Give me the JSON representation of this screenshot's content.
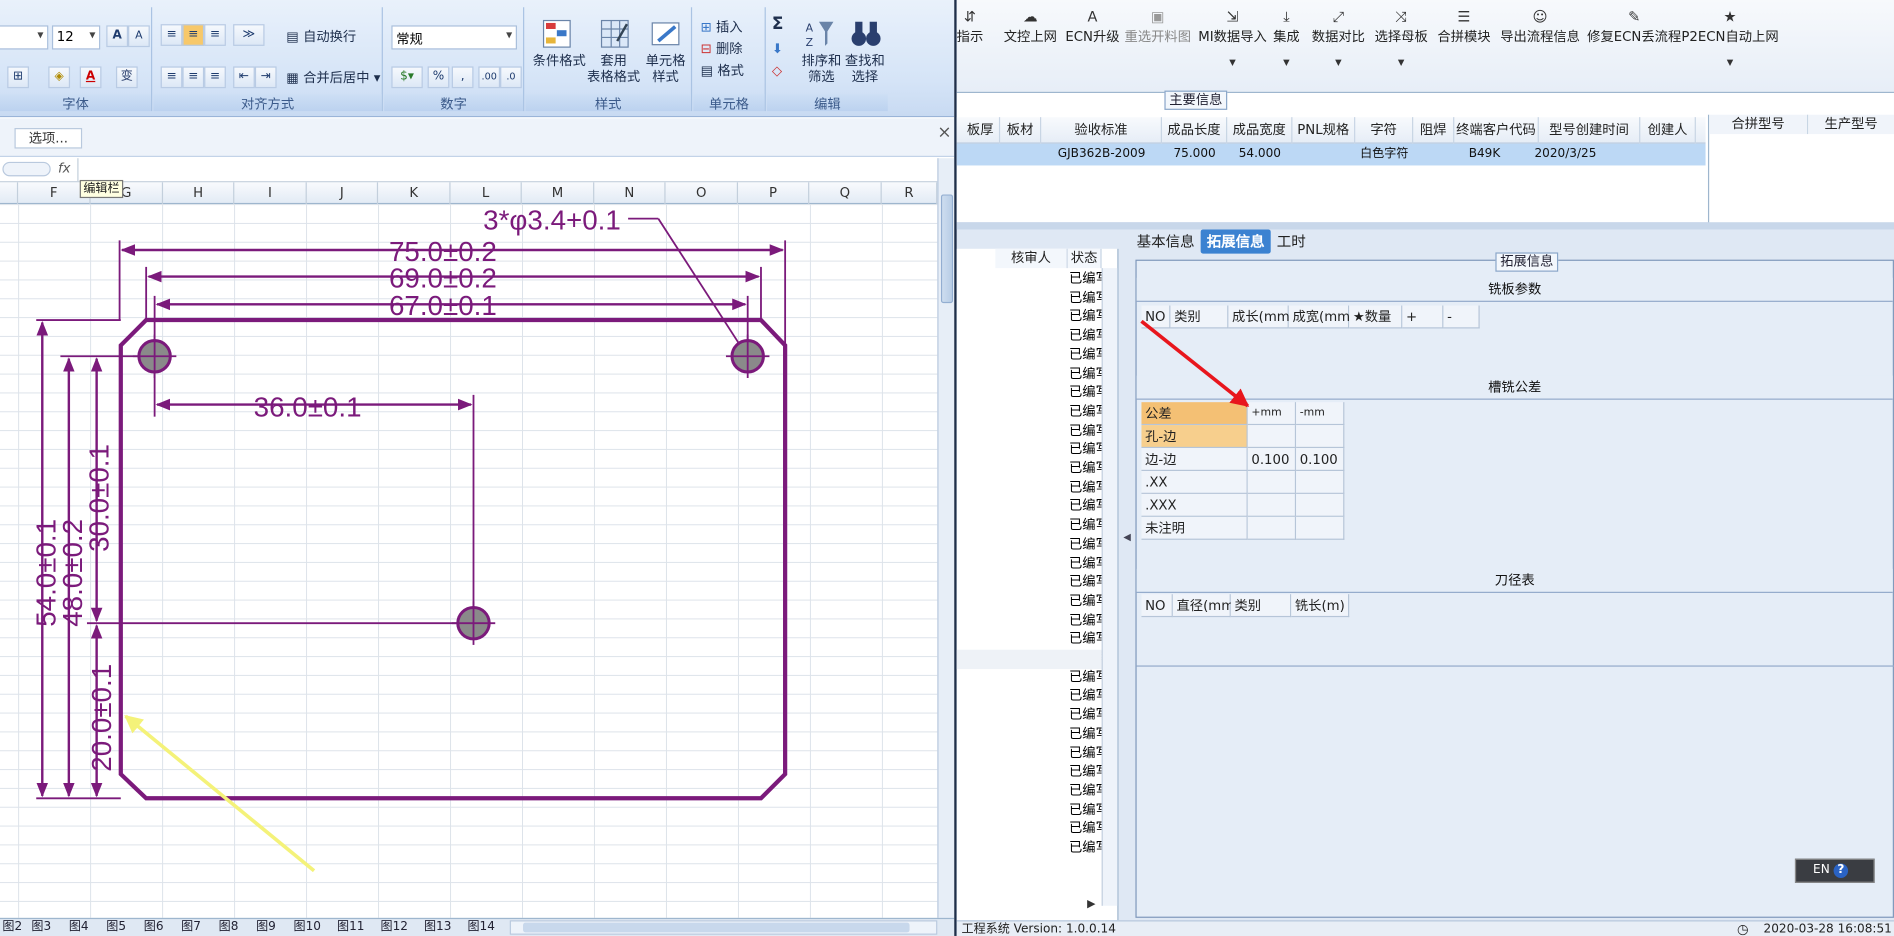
{
  "excel": {
    "font_size": "12",
    "wrap_text": "自动换行",
    "merge_center": "合并后居中",
    "number_format": "常规",
    "percent": "%",
    "comma": ",",
    "dec_inc": ".00",
    "dec_dec": ".0",
    "cond_format": "条件格式",
    "table_format": "套用\n表格格式",
    "cell_style": "单元格\n样式",
    "insert": "插入",
    "delete": "删除",
    "format": "格式",
    "sigma": "Σ",
    "sort_filter": "排序和\n筛选",
    "find_select": "查找和\n选择",
    "group_labels": [
      "字体",
      "对齐方式",
      "数字",
      "样式",
      "单元格",
      "编辑"
    ],
    "options_button": "选项...",
    "close": "×",
    "fx": "fx",
    "tooltip": "编辑栏",
    "columns": [
      "F",
      "G",
      "H",
      "I",
      "J",
      "K",
      "L",
      "M",
      "N",
      "O",
      "P",
      "Q",
      "R"
    ],
    "sheet_tabs": [
      "图2",
      "图3",
      "图4",
      "图5",
      "图6",
      "图7",
      "图8",
      "图9",
      "图10",
      "图11",
      "图12",
      "图13",
      "图14"
    ],
    "drawing": {
      "hole_label": "3*φ3.4+0.1",
      "dim_75": "75.0±0.2",
      "dim_69": "69.0±0.2",
      "dim_67": "67.0±0.1",
      "dim_36": "36.0±0.1",
      "dim_30": "30.0±0.1",
      "dim_54": "54.0±0.1",
      "dim_48": "48.0±0.2",
      "dim_20": "20.0±0.1"
    }
  },
  "toolbar": [
    {
      "icon": "⇵",
      "label": "指示"
    },
    {
      "icon": "☁",
      "label": "文控上网"
    },
    {
      "icon": "A",
      "label": "ECN升级"
    },
    {
      "icon": "▣",
      "label": "重选开料图"
    },
    {
      "icon": "⇲",
      "label": "MI数据导入"
    },
    {
      "icon": "⤓",
      "label": "集成"
    },
    {
      "icon": "⤢",
      "label": "数据对比"
    },
    {
      "icon": "⤨",
      "label": "选择母板"
    },
    {
      "icon": "☰",
      "label": "合拼模块"
    },
    {
      "icon": "☺",
      "label": "导出流程信息"
    },
    {
      "icon": "✎",
      "label": "修复ECN丢流程"
    },
    {
      "icon": "★",
      "label": "P2ECN自动上网"
    }
  ],
  "main_info": {
    "title": "主要信息",
    "headers": [
      "板厚",
      "板材",
      "验收标准",
      "成品长度",
      "成品宽度",
      "PNL规格",
      "字符",
      "阻焊",
      "终端客户代码",
      "型号创建时间",
      "创建人"
    ],
    "row": [
      "",
      "",
      "GJB362B-2009",
      "75.000",
      "54.000",
      "",
      "白色字符",
      "",
      "B49K",
      "2020/3/25",
      ""
    ],
    "side_headers": [
      "合拼型号",
      "生产型号"
    ]
  },
  "left_list": {
    "headers": [
      "核审人",
      "状态"
    ],
    "status_value": "已编写",
    "status_count": 31
  },
  "tabs": [
    "基本信息",
    "拓展信息",
    "工时"
  ],
  "active_tab": "拓展信息",
  "extended": {
    "title": "拓展信息",
    "board_title": "铣板参数",
    "board_headers": [
      "NO",
      "类别",
      "成长(mm)",
      "成宽(mm)",
      "★数量",
      "+",
      "-"
    ],
    "tolerance_title": "槽铣公差",
    "tolerance_headers": [
      "公差",
      "+mm",
      "-mm"
    ],
    "tolerance_rows": [
      {
        "label": "孔-边",
        "plus": "",
        "minus": ""
      },
      {
        "label": "边-边",
        "plus": "0.100",
        "minus": "0.100"
      },
      {
        "label": ".XX",
        "plus": "",
        "minus": ""
      },
      {
        "label": ".XXX",
        "plus": "",
        "minus": ""
      },
      {
        "label": "未注明",
        "plus": "",
        "minus": ""
      }
    ],
    "tool_title": "刀径表",
    "tool_headers": [
      "NO",
      "直径(mm)",
      "类别",
      "铣长(m)"
    ]
  },
  "status_bar": {
    "left": "工程系统 Version: 1.0.0.14",
    "right": "2020-03-28 16:08:51"
  },
  "lang": "EN",
  "colors": {
    "drawing": "#7b1a7b",
    "red_arrow": "#e8161d",
    "yellow_arrow": "#f4f279",
    "active_tab": "#3b82d1",
    "row_highlight": "#bcd8f5",
    "tolerance_header": "#f4c074"
  }
}
